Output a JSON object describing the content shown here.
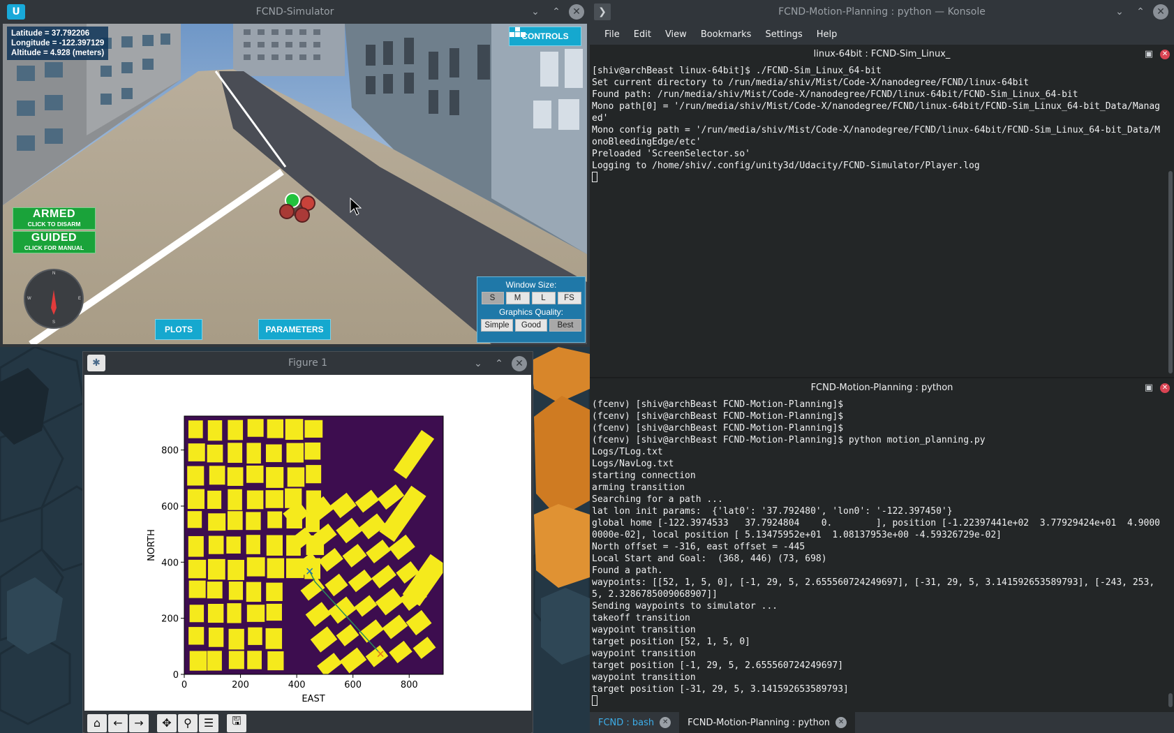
{
  "simulator": {
    "title": "FCND-Simulator",
    "hud": {
      "latitude": "Latitude = 37.792206",
      "longitude": "Longitude = -122.397129",
      "altitude": "Altitude = 4.928 (meters)"
    },
    "controls_label": "CONTROLS",
    "armed_label": "ARMED",
    "armed_sub": "CLICK TO DISARM",
    "guided_label": "GUIDED",
    "guided_sub": "CLICK FOR MANUAL",
    "compass": {
      "n": "N",
      "s": "S",
      "e": "E",
      "w": "W"
    },
    "plots_label": "PLOTS",
    "parameters_label": "PARAMETERS",
    "window_size_label": "Window Size:",
    "window_sizes": [
      "S",
      "M",
      "L",
      "FS"
    ],
    "window_size_selected": "S",
    "graphics_quality_label": "Graphics Quality:",
    "graphics_qualities": [
      "Simple",
      "Good",
      "Best"
    ],
    "graphics_selected": "Best"
  },
  "figure": {
    "title": "Figure 1",
    "toolbar": [
      "home-icon",
      "back-arrow-icon",
      "forward-arrow-icon",
      "pan-icon",
      "zoom-icon",
      "configure-subplots-icon",
      "save-icon"
    ],
    "chart_data": {
      "type": "heatmap",
      "title": "",
      "xlabel": "EAST",
      "ylabel": "NORTH",
      "xlim": [
        0,
        921
      ],
      "ylim": [
        0,
        921
      ],
      "xticks": [
        0,
        200,
        400,
        600,
        800
      ],
      "yticks": [
        0,
        200,
        400,
        600,
        800
      ],
      "colors": {
        "obstacle": "#f5ea1c",
        "free": "#3d0d4f",
        "path": "#2a8a5a",
        "start_goal": "#e3791e"
      },
      "path": [
        [
          446,
          368
        ],
        [
          465,
          330
        ],
        [
          698,
          73
        ]
      ],
      "start": [
        446,
        368
      ],
      "goal": [
        698,
        73
      ]
    }
  },
  "konsole": {
    "title": "FCND-Motion-Planning : python — Konsole",
    "menu": [
      "File",
      "Edit",
      "View",
      "Bookmarks",
      "Settings",
      "Help"
    ],
    "pane1_title": "linux-64bit : FCND-Sim_Linux_",
    "pane1_lines": [
      "[shiv@archBeast linux-64bit]$ ./FCND-Sim_Linux_64-bit",
      "Set current directory to /run/media/shiv/Mist/Code-X/nanodegree/FCND/linux-64bit",
      "Found path: /run/media/shiv/Mist/Code-X/nanodegree/FCND/linux-64bit/FCND-Sim_Linux_64-bit",
      "Mono path[0] = '/run/media/shiv/Mist/Code-X/nanodegree/FCND/linux-64bit/FCND-Sim_Linux_64-bit_Data/Managed'",
      "Mono config path = '/run/media/shiv/Mist/Code-X/nanodegree/FCND/linux-64bit/FCND-Sim_Linux_64-bit_Data/MonoBleedingEdge/etc'",
      "Preloaded 'ScreenSelector.so'",
      "Logging to /home/shiv/.config/unity3d/Udacity/FCND-Simulator/Player.log"
    ],
    "pane2_title": "FCND-Motion-Planning : python",
    "pane2_lines": [
      "(fcenv) [shiv@archBeast FCND-Motion-Planning]$",
      "(fcenv) [shiv@archBeast FCND-Motion-Planning]$",
      "(fcenv) [shiv@archBeast FCND-Motion-Planning]$",
      "(fcenv) [shiv@archBeast FCND-Motion-Planning]$ python motion_planning.py",
      "Logs/TLog.txt",
      "Logs/NavLog.txt",
      "starting connection",
      "arming transition",
      "Searching for a path ...",
      "lat lon init params:  {'lat0': '37.792480', 'lon0': '-122.397450'}",
      "global home [-122.3974533   37.7924804    0.        ], position [-1.22397441e+02  3.77929424e+01  4.90000000e-02], local position [ 5.13475952e+01  1.08137953e+00 -4.59326729e-02]",
      "North offset = -316, east offset = -445",
      "Local Start and Goal:  (368, 446) (73, 698)",
      "Found a path.",
      "waypoints: [[52, 1, 5, 0], [-1, 29, 5, 2.655560724249697], [-31, 29, 5, 3.141592653589793], [-243, 253, 5, 2.3286785009068907]]",
      "Sending waypoints to simulator ...",
      "takeoff transition",
      "waypoint transition",
      "target position [52, 1, 5, 0]",
      "waypoint transition",
      "target position [-1, 29, 5, 2.655560724249697]",
      "waypoint transition",
      "target position [-31, 29, 5, 3.141592653589793]"
    ],
    "tabs": [
      {
        "label": "FCND : bash"
      },
      {
        "label": "FCND-Motion-Planning : python"
      }
    ]
  }
}
